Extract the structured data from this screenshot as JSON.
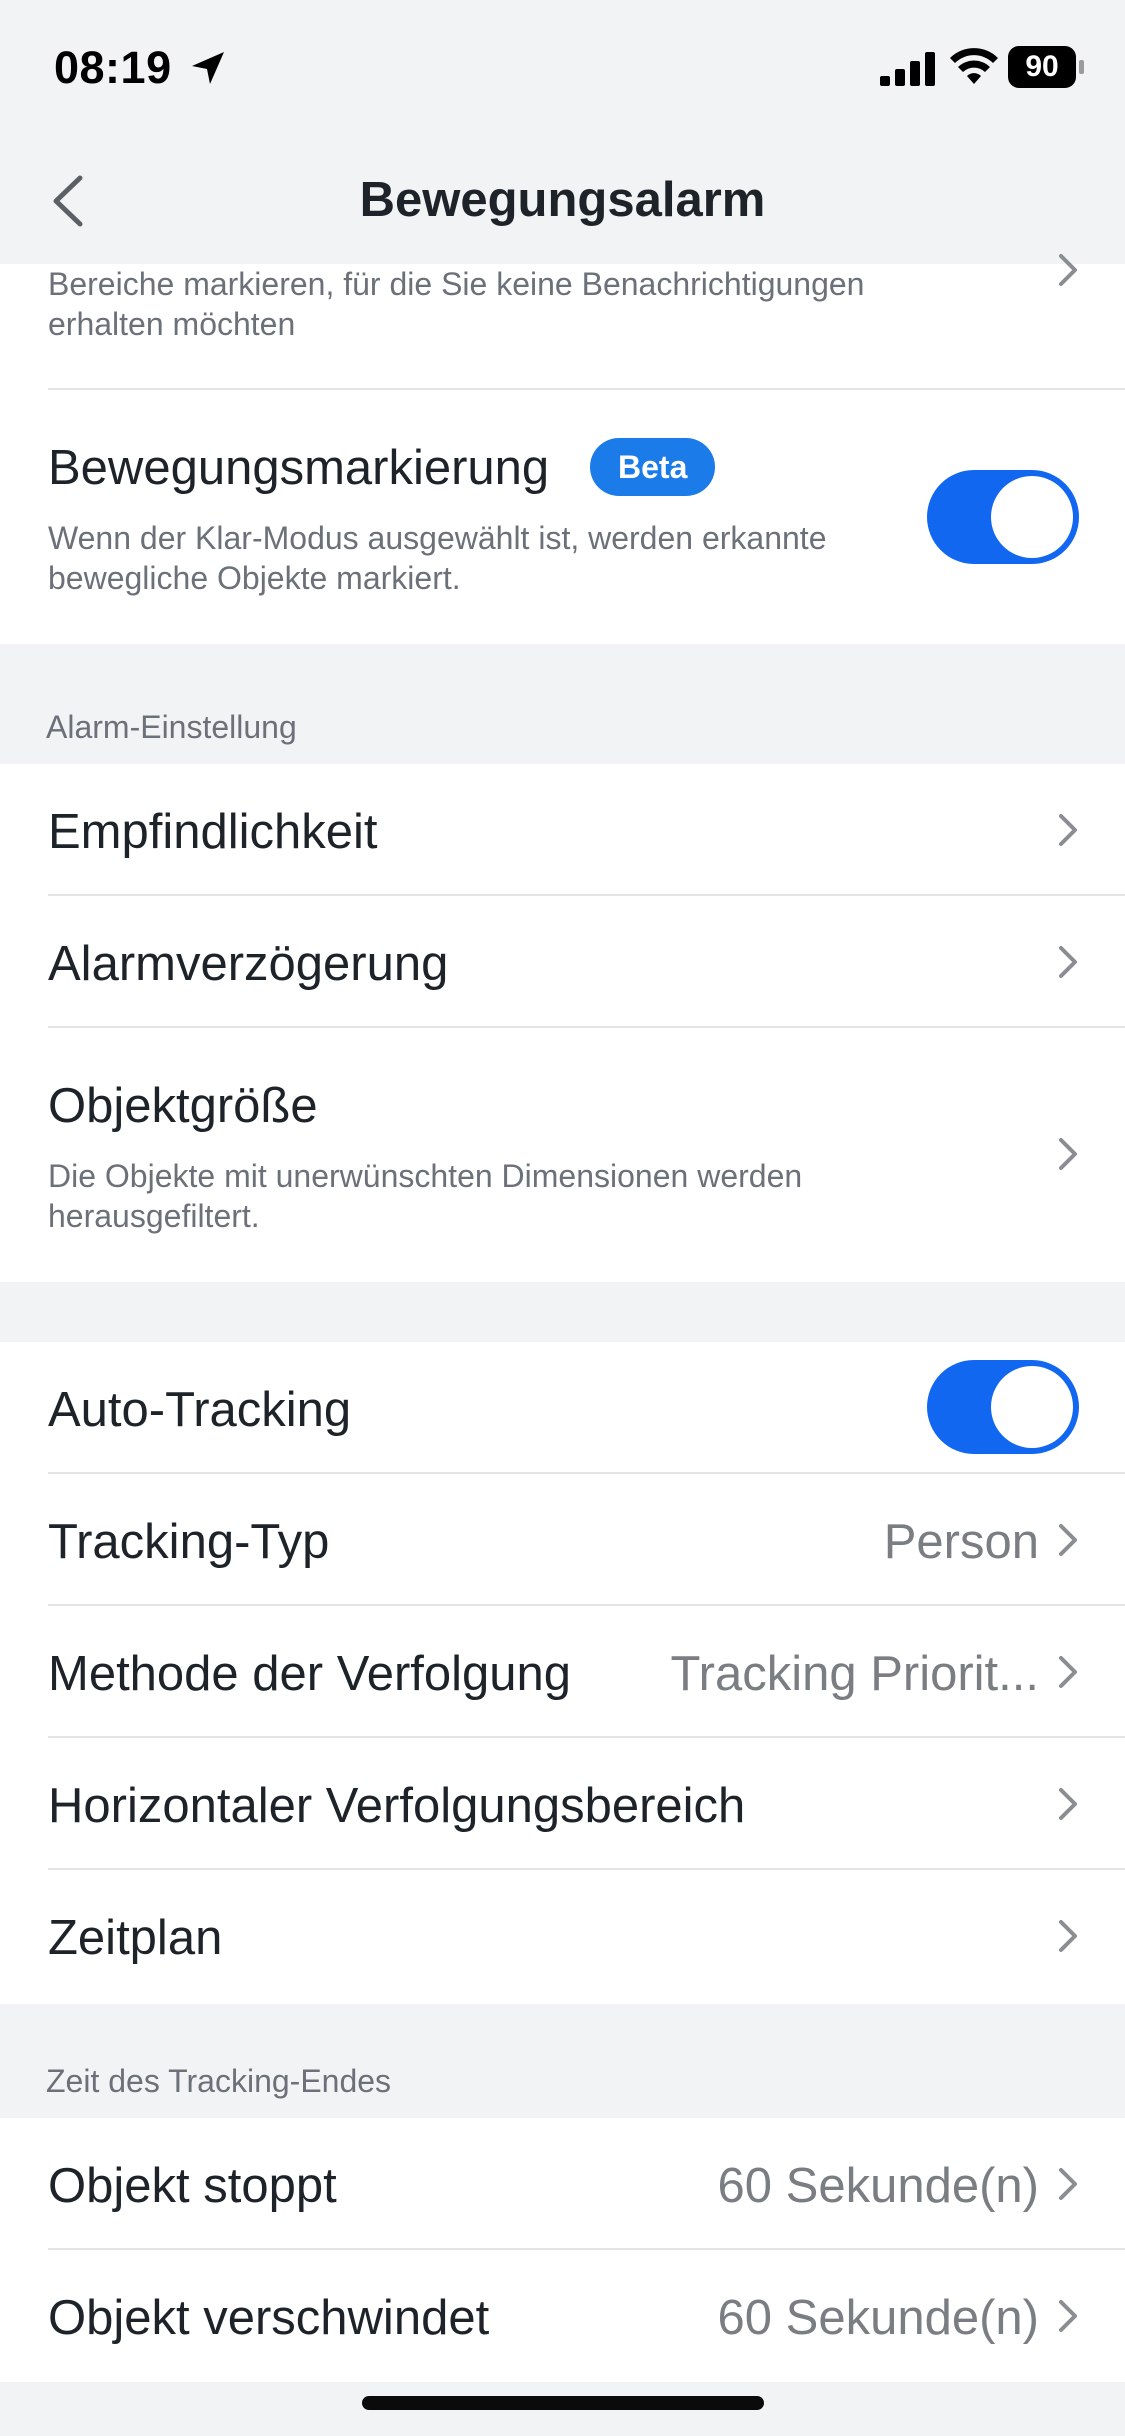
{
  "status_bar": {
    "time": "08:19",
    "battery": "90"
  },
  "nav": {
    "title": "Bewegungsalarm",
    "back_icon": "chevron-left-icon"
  },
  "top_group": {
    "partial_row_subtitle": "Bereiche markieren, für die Sie keine Benachrichtigungen erhalten möchten",
    "motion_marking": {
      "title": "Bewegungsmarkierung",
      "badge": "Beta",
      "subtitle": "Wenn der Klar-Modus ausgewählt ist, werden erkannte bewegliche Objekte markiert.",
      "enabled": true
    }
  },
  "alarm_section": {
    "header": "Alarm-Einstellung",
    "items": [
      {
        "title": "Empfindlichkeit"
      },
      {
        "title": "Alarmverzögerung"
      },
      {
        "title": "Objektgröße",
        "subtitle": "Die Objekte mit unerwünschten Dimensionen werden herausgefiltert."
      }
    ]
  },
  "tracking_section": {
    "auto_tracking": {
      "title": "Auto-Tracking",
      "enabled": true
    },
    "items": [
      {
        "title": "Tracking-Typ",
        "value": "Person"
      },
      {
        "title": "Methode der Verfolgung",
        "value": "Tracking Priorit..."
      },
      {
        "title": "Horizontaler Verfolgungsbereich"
      },
      {
        "title": "Zeitplan"
      }
    ]
  },
  "tracking_end_section": {
    "header": "Zeit des Tracking-Endes",
    "items": [
      {
        "title": "Objekt stoppt",
        "value": "60 Sekunde(n)"
      },
      {
        "title": "Objekt verschwindet",
        "value": "60 Sekunde(n)"
      }
    ]
  },
  "colors": {
    "accent": "#1167f0",
    "badge": "#1b7be8",
    "background": "#f2f3f5"
  }
}
